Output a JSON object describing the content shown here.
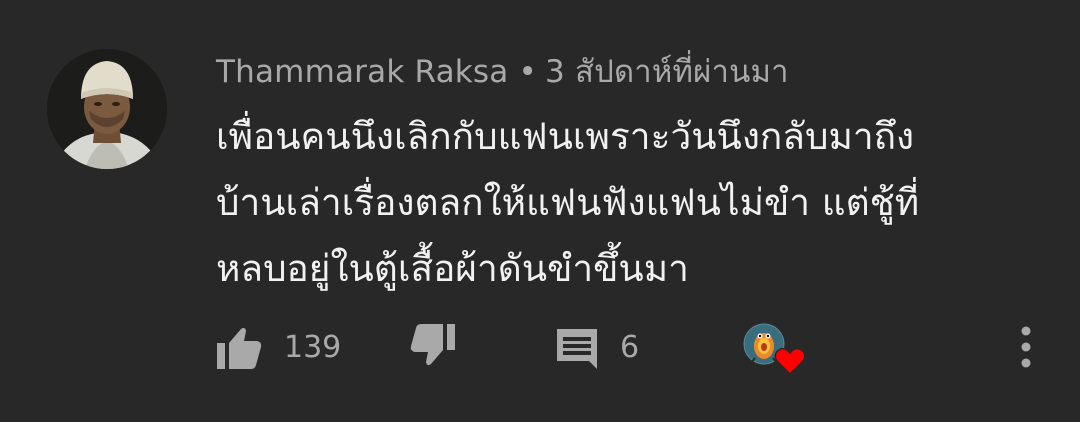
{
  "comment": {
    "author": "Thammarak Raksa",
    "separator": "•",
    "timestamp": "3 สัปดาห์ที่ผ่านมา",
    "text_lines": [
      "เพื่อนคนนึงเลิกกับแฟนเพราะวันนึงกลับมาถึง",
      "บ้านเล่าเรื่องตลกให้แฟนฟังแฟนไม่ขำ แต่ชู้ที่",
      "หลบอยู่ในตู้เสื้อผ้าดันขำขึ้นมา"
    ]
  },
  "actions": {
    "like_count": "139",
    "reply_count": "6"
  },
  "icons": {
    "like": "thumbs-up-icon",
    "dislike": "thumbs-down-icon",
    "reply": "comment-icon",
    "creator_heart": "heart-icon",
    "more": "more-vertical-icon"
  },
  "colors": {
    "background": "#282828",
    "text_primary": "#f1f1f1",
    "text_secondary": "#a9a9a9",
    "heart": "#ff0000"
  }
}
